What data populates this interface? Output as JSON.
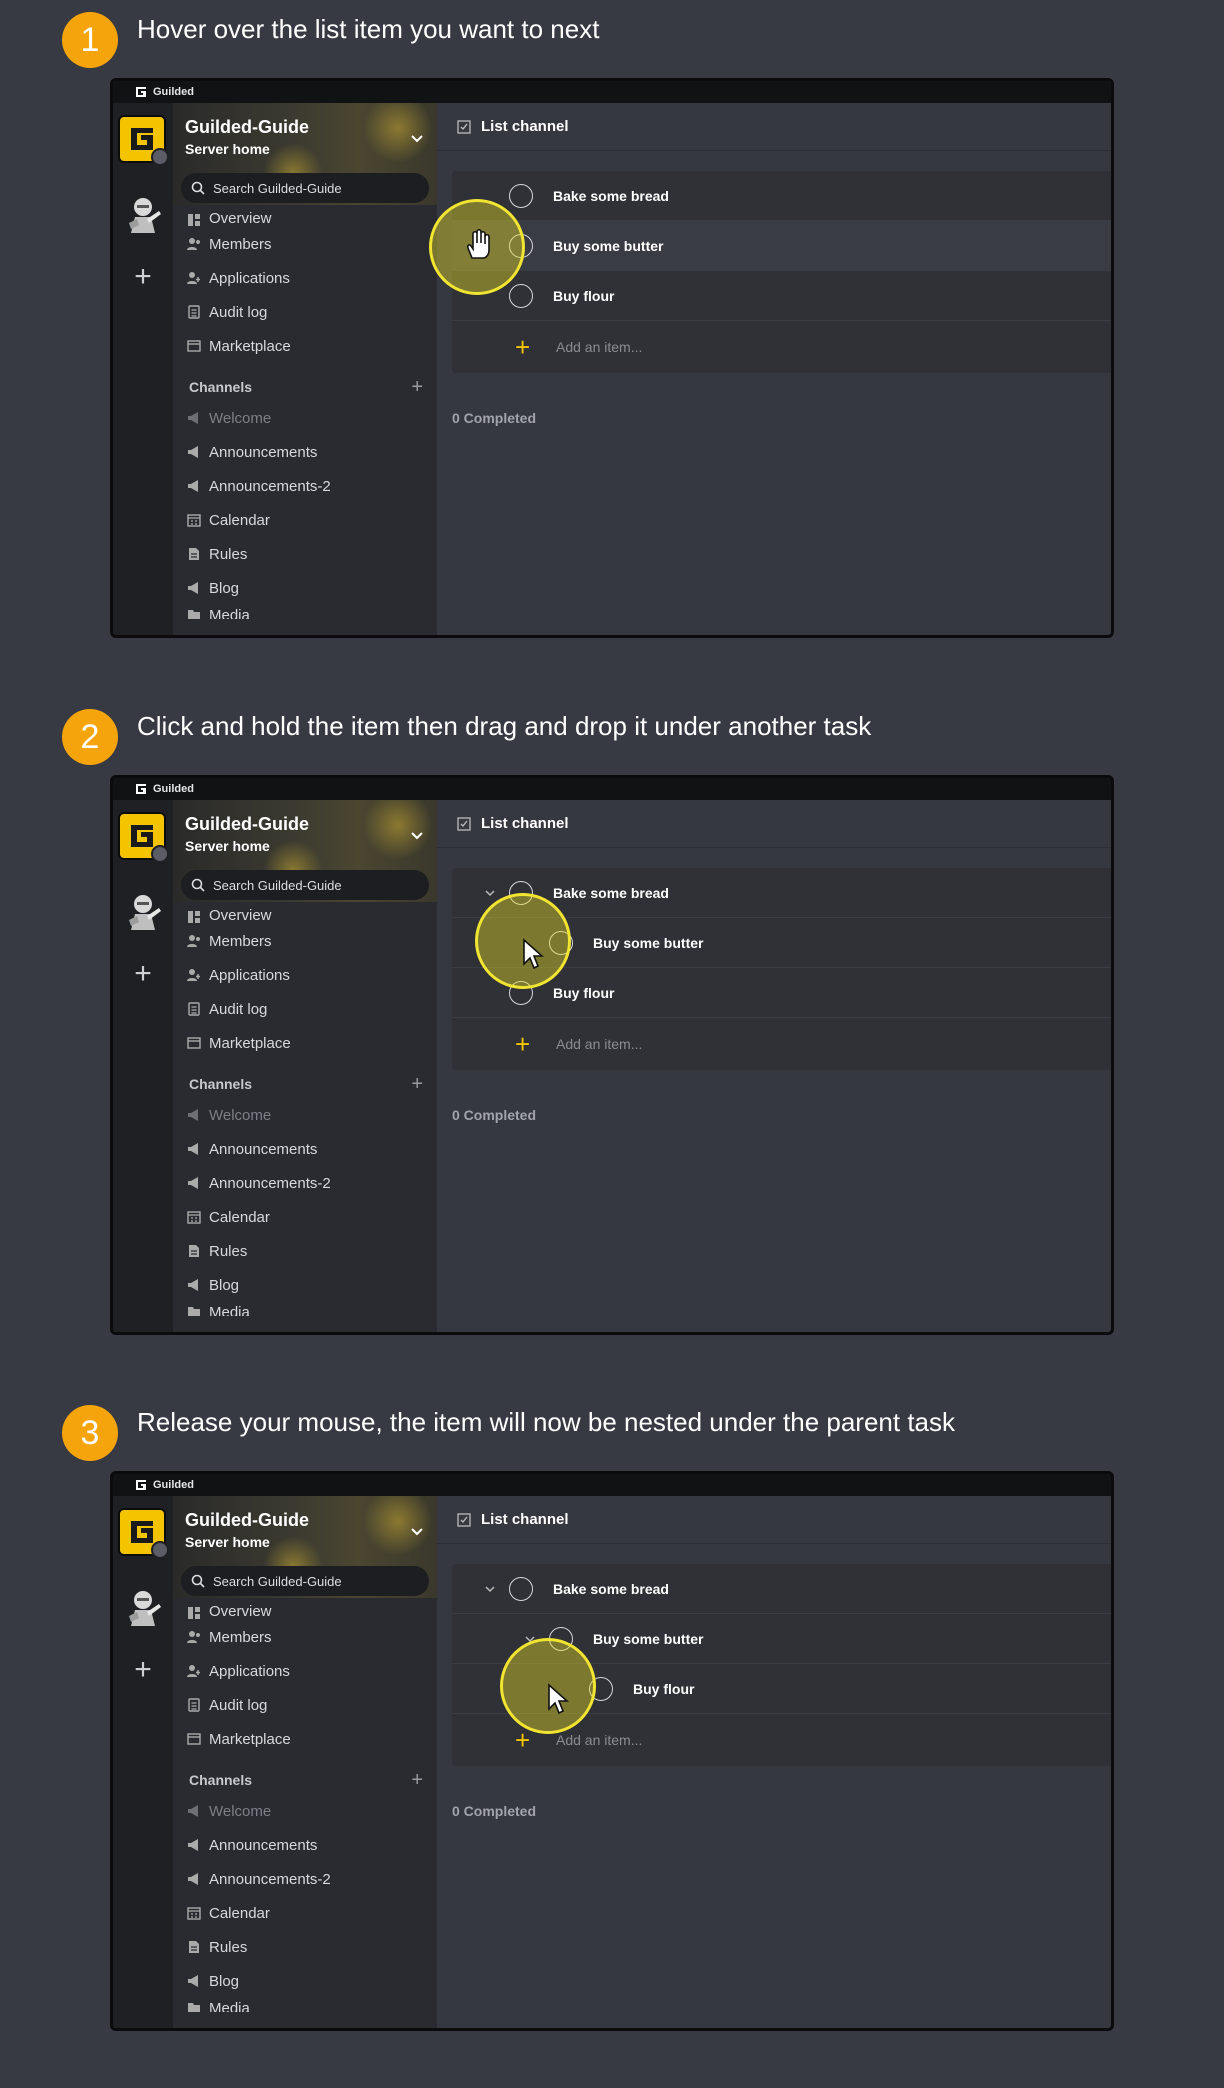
{
  "steps": [
    {
      "number": "1",
      "instruction": "Hover over the list item you want to next"
    },
    {
      "number": "2",
      "instruction": "Click and hold the item then drag and drop it under another task"
    },
    {
      "number": "3",
      "instruction": "Release your mouse, the item will now be nested under the parent task"
    }
  ],
  "app": {
    "window_title": "Guilded",
    "server_name": "Guilded-Guide",
    "server_subtitle": "Server home",
    "search_placeholder": "Search Guilded-Guide",
    "nav_items": {
      "overview": "Overview",
      "members": "Members",
      "applications": "Applications",
      "audit_log": "Audit log",
      "marketplace": "Marketplace"
    },
    "channels_heading": "Channels",
    "channels": {
      "welcome": "Welcome",
      "announcements": "Announcements",
      "announcements_2": "Announcements-2",
      "calendar": "Calendar",
      "rules": "Rules",
      "blog": "Blog",
      "media": "Media"
    },
    "channel_title": "List channel",
    "items": {
      "bread": "Bake some bread",
      "butter": "Buy some butter",
      "flour": "Buy flour"
    },
    "add_item_placeholder": "Add an item...",
    "completed_label": "0 Completed"
  },
  "colors": {
    "accent": "#f5c400",
    "step_badge": "#f5a40c",
    "page_bg": "#383a43",
    "cursor_highlight": "#f1e532"
  },
  "icons": [
    "guilded-logo-icon",
    "chevron-down-icon",
    "search-icon",
    "overview-icon",
    "members-icon",
    "applications-icon",
    "audit-log-icon",
    "marketplace-icon",
    "announcement-icon",
    "calendar-icon",
    "rules-icon",
    "checklist-icon",
    "plus-icon",
    "hand-cursor-icon",
    "arrow-cursor-icon"
  ]
}
